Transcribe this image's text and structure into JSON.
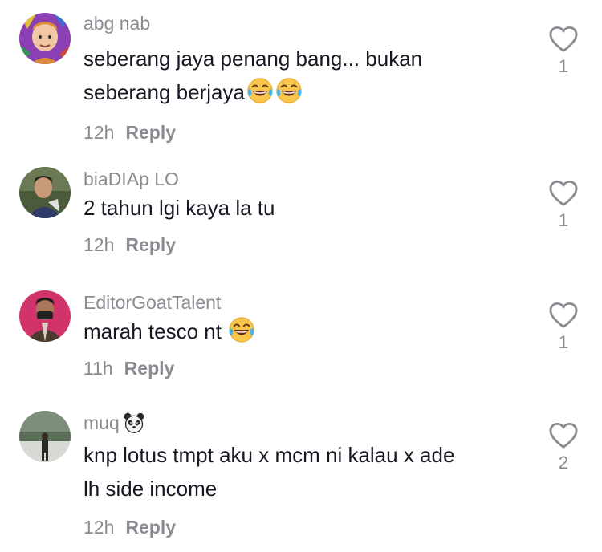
{
  "comments": [
    {
      "username": "abg nab",
      "text_line1": "seberang jaya penang bang... bukan",
      "text_line2": "seberang berjaya",
      "time": "12h",
      "reply_label": "Reply",
      "likes": "1",
      "emoji": "face-with-tears-of-joy"
    },
    {
      "username": "biaDIAp LO",
      "text": "2 tahun lgi kaya la tu",
      "time": "12h",
      "reply_label": "Reply",
      "likes": "1"
    },
    {
      "username": "EditorGoatTalent",
      "text": "marah tesco nt",
      "time": "11h",
      "reply_label": "Reply",
      "likes": "1",
      "emoji": "face-with-tears-of-joy"
    },
    {
      "username": "muq",
      "username_emoji": "panda-face",
      "text_line1": "knp lotus tmpt aku x mcm ni kalau x ade",
      "text_line2": "lh side income",
      "time": "12h",
      "reply_label": "Reply",
      "likes": "2"
    }
  ],
  "icons": {
    "like": "heart-outline-icon"
  },
  "colors": {
    "text": "#161823",
    "secondary": "#8a8b91",
    "background": "#ffffff"
  }
}
